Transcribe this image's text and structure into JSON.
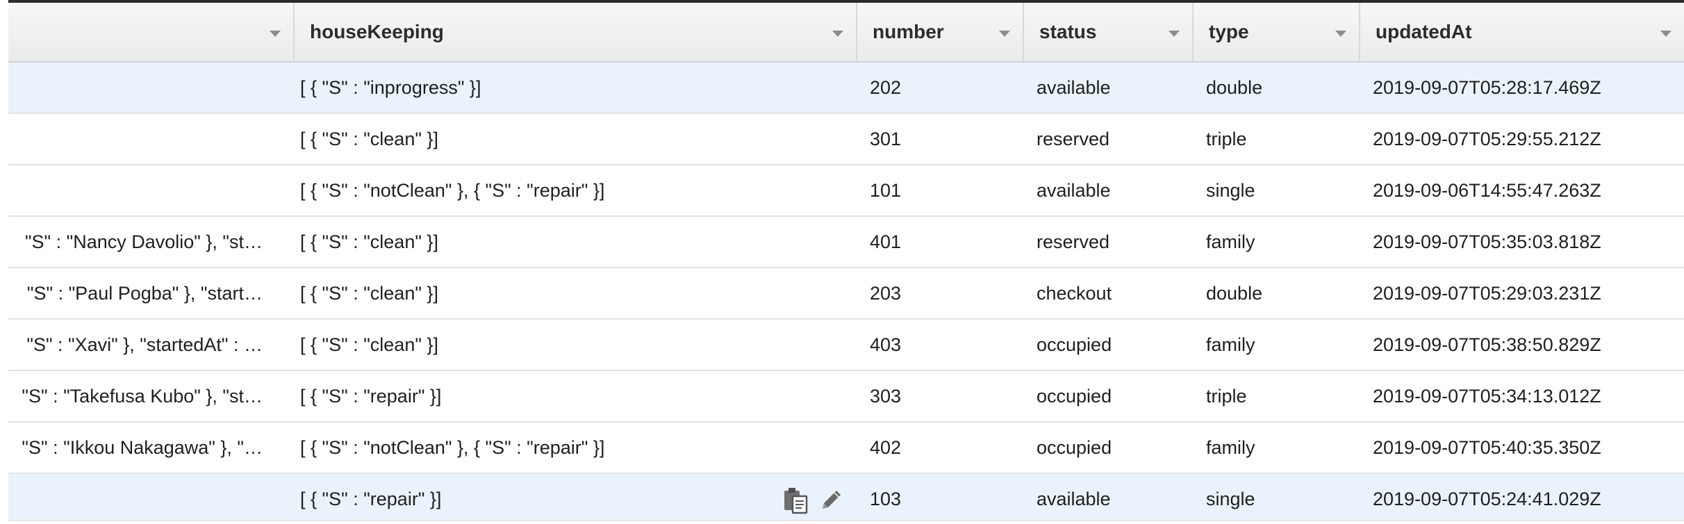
{
  "columns": [
    {
      "label": ""
    },
    {
      "label": "houseKeeping"
    },
    {
      "label": "number"
    },
    {
      "label": "status"
    },
    {
      "label": "type"
    },
    {
      "label": "updatedAt"
    }
  ],
  "rows": [
    {
      "col0": "",
      "houseKeeping": "[ { \"S\" : \"inprogress\" }]",
      "number": "202",
      "status": "available",
      "type": "double",
      "updatedAt": "2019-09-07T05:28:17.469Z"
    },
    {
      "col0": "",
      "houseKeeping": "[ { \"S\" : \"clean\" }]",
      "number": "301",
      "status": "reserved",
      "type": "triple",
      "updatedAt": "2019-09-07T05:29:55.212Z"
    },
    {
      "col0": "",
      "houseKeeping": "[ { \"S\" : \"notClean\" }, { \"S\" : \"repair\" }]",
      "number": "101",
      "status": "available",
      "type": "single",
      "updatedAt": "2019-09-06T14:55:47.263Z"
    },
    {
      "col0": "\"S\" : \"Nancy Davolio\" }, \"st…",
      "houseKeeping": "[ { \"S\" : \"clean\" }]",
      "number": "401",
      "status": "reserved",
      "type": "family",
      "updatedAt": "2019-09-07T05:35:03.818Z"
    },
    {
      "col0": "\"S\" : \"Paul Pogba\" }, \"start…",
      "houseKeeping": "[ { \"S\" : \"clean\" }]",
      "number": "203",
      "status": "checkout",
      "type": "double",
      "updatedAt": "2019-09-07T05:29:03.231Z"
    },
    {
      "col0": "\"S\" : \"Xavi\" }, \"startedAt\" : …",
      "houseKeeping": "[ { \"S\" : \"clean\" }]",
      "number": "403",
      "status": "occupied",
      "type": "family",
      "updatedAt": "2019-09-07T05:38:50.829Z"
    },
    {
      "col0": "\"S\" : \"Takefusa Kubo\" }, \"st…",
      "houseKeeping": "[ { \"S\" : \"repair\" }]",
      "number": "303",
      "status": "occupied",
      "type": "triple",
      "updatedAt": "2019-09-07T05:34:13.012Z"
    },
    {
      "col0": "\"S\" : \"Ikkou Nakagawa\" }, \"…",
      "houseKeeping": "[ { \"S\" : \"notClean\" }, { \"S\" : \"repair\" }]",
      "number": "402",
      "status": "occupied",
      "type": "family",
      "updatedAt": "2019-09-07T05:40:35.350Z"
    },
    {
      "col0": "",
      "houseKeeping": "[ { \"S\" : \"repair\" }]",
      "number": "103",
      "status": "available",
      "type": "single",
      "updatedAt": "2019-09-07T05:24:41.029Z"
    }
  ],
  "row_actions": {
    "copy_icon": "copy-icon",
    "edit_icon": "pencil-icon"
  },
  "colors": {
    "selected_row": "#eaf2fb",
    "header_text": "#2c2c2c",
    "icon": "#555555"
  }
}
